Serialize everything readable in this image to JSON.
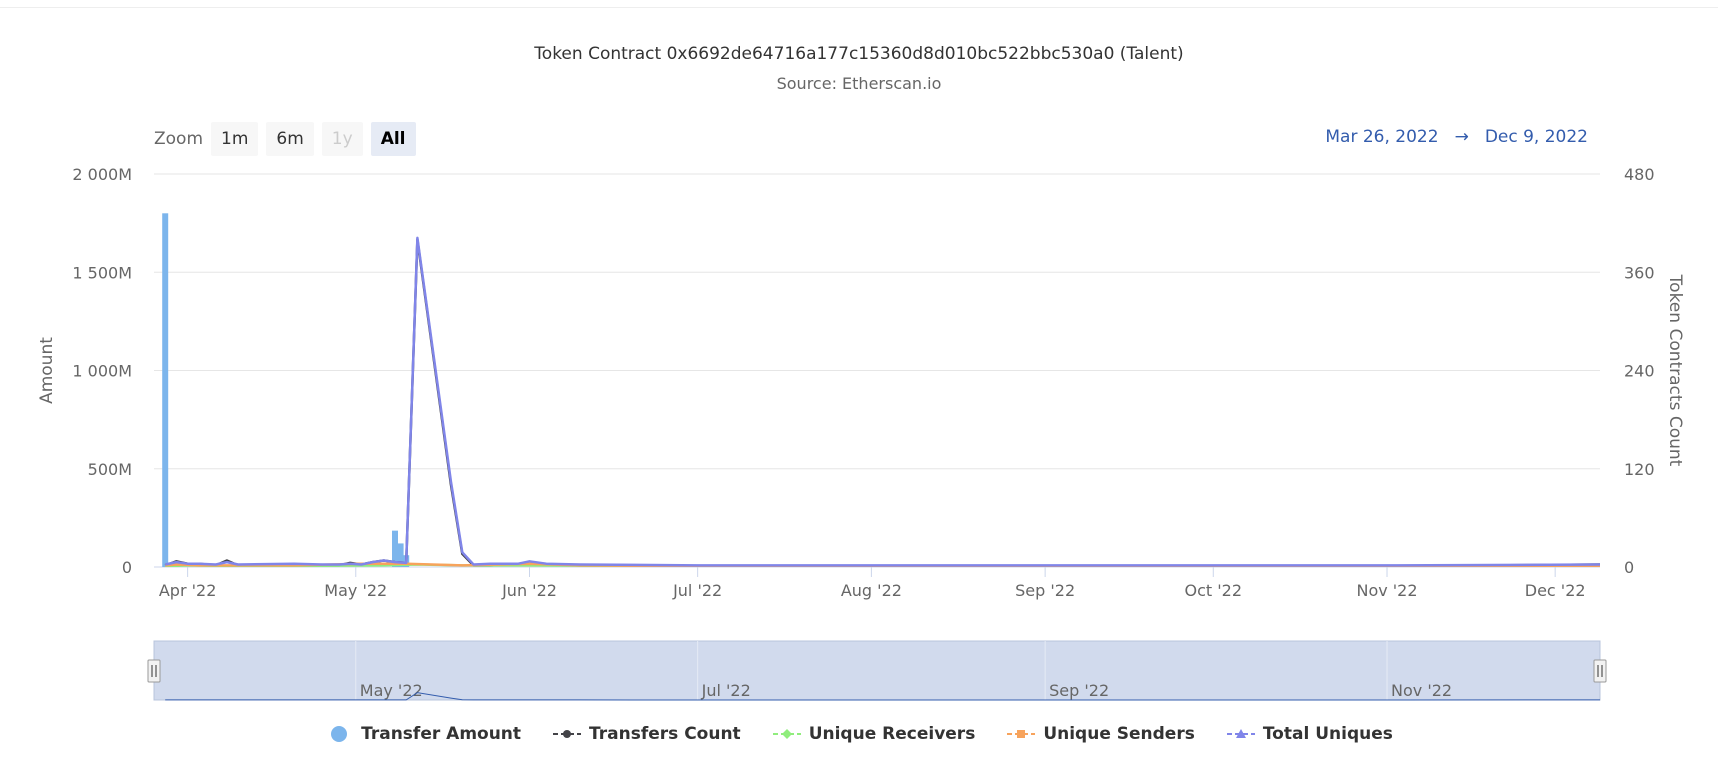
{
  "colors": {
    "transfer_amount": "#7cb5ec",
    "transfers_count": "#434348",
    "unique_receivers": "#90ed7d",
    "unique_senders": "#f7a35c",
    "total_uniques": "#8085e9",
    "navigator_fill": "#ccd6eb",
    "range_text": "#335cad"
  },
  "zoom": {
    "label": "Zoom",
    "buttons": [
      {
        "label": "1m",
        "state": "normal"
      },
      {
        "label": "6m",
        "state": "normal"
      },
      {
        "label": "1y",
        "state": "disabled"
      },
      {
        "label": "All",
        "state": "active"
      }
    ]
  },
  "range": {
    "from": "Mar 26, 2022",
    "arrow": "→",
    "to": "Dec 9, 2022"
  },
  "chart_data": {
    "type": "line",
    "title": "Token Contract 0x6692de64716a177c15360d8d010bc522bbc530a0 (Talent)",
    "subtitle": "Source: Etherscan.io",
    "x_range": [
      "2022-03-26",
      "2022-12-09"
    ],
    "x_ticks": [
      {
        "date": "2022-04-01",
        "label": "Apr '22"
      },
      {
        "date": "2022-05-01",
        "label": "May '22"
      },
      {
        "date": "2022-06-01",
        "label": "Jun '22"
      },
      {
        "date": "2022-07-01",
        "label": "Jul '22"
      },
      {
        "date": "2022-08-01",
        "label": "Aug '22"
      },
      {
        "date": "2022-09-01",
        "label": "Sep '22"
      },
      {
        "date": "2022-10-01",
        "label": "Oct '22"
      },
      {
        "date": "2022-11-01",
        "label": "Nov '22"
      },
      {
        "date": "2022-12-01",
        "label": "Dec '22"
      }
    ],
    "y_left": {
      "label": "Amount",
      "range": [
        0,
        2000
      ],
      "ticks": [
        "0",
        "500M",
        "1 000M",
        "1 500M",
        "2 000M"
      ]
    },
    "y_right": {
      "label": "Token Contracts Count",
      "range": [
        0,
        480
      ],
      "ticks": [
        "0",
        "120",
        "240",
        "360",
        "480"
      ]
    },
    "grid": true,
    "legend_position": "bottom",
    "series": [
      {
        "name": "Transfer Amount",
        "axis": "left",
        "kind": "column",
        "unit": "M",
        "points": [
          [
            "2022-03-28",
            1800
          ],
          [
            "2022-05-08",
            185
          ],
          [
            "2022-05-09",
            120
          ],
          [
            "2022-05-10",
            60
          ]
        ]
      },
      {
        "name": "Transfers Count",
        "axis": "right",
        "kind": "line",
        "points": [
          [
            "2022-03-28",
            2
          ],
          [
            "2022-03-30",
            7
          ],
          [
            "2022-04-01",
            4
          ],
          [
            "2022-04-03",
            4
          ],
          [
            "2022-04-06",
            2
          ],
          [
            "2022-04-08",
            8
          ],
          [
            "2022-04-10",
            2
          ],
          [
            "2022-04-20",
            3
          ],
          [
            "2022-04-25",
            2
          ],
          [
            "2022-04-28",
            2
          ],
          [
            "2022-04-30",
            5
          ],
          [
            "2022-05-02",
            3
          ],
          [
            "2022-05-04",
            6
          ],
          [
            "2022-05-06",
            8
          ],
          [
            "2022-05-08",
            6
          ],
          [
            "2022-05-10",
            5
          ],
          [
            "2022-05-12",
            400
          ],
          [
            "2022-05-18",
            100
          ],
          [
            "2022-05-20",
            16
          ],
          [
            "2022-05-22",
            2
          ],
          [
            "2022-05-25",
            2
          ],
          [
            "2022-05-30",
            3
          ],
          [
            "2022-06-01",
            6
          ],
          [
            "2022-06-04",
            3
          ],
          [
            "2022-06-10",
            2
          ],
          [
            "2022-07-01",
            1
          ],
          [
            "2022-09-01",
            1
          ],
          [
            "2022-11-01",
            1
          ],
          [
            "2022-12-09",
            3
          ]
        ]
      },
      {
        "name": "Unique Receivers",
        "axis": "right",
        "kind": "line",
        "points": [
          [
            "2022-03-28",
            1
          ],
          [
            "2022-04-01",
            2
          ],
          [
            "2022-04-10",
            1
          ],
          [
            "2022-05-05",
            2
          ],
          [
            "2022-05-12",
            3
          ],
          [
            "2022-05-20",
            2
          ],
          [
            "2022-06-01",
            2
          ],
          [
            "2022-07-01",
            1
          ],
          [
            "2022-12-09",
            1
          ]
        ]
      },
      {
        "name": "Unique Senders",
        "axis": "right",
        "kind": "line",
        "points": [
          [
            "2022-03-28",
            2
          ],
          [
            "2022-03-30",
            3
          ],
          [
            "2022-04-03",
            2
          ],
          [
            "2022-04-20",
            2
          ],
          [
            "2022-05-02",
            4
          ],
          [
            "2022-05-10",
            4
          ],
          [
            "2022-05-20",
            2
          ],
          [
            "2022-06-01",
            4
          ],
          [
            "2022-06-10",
            2
          ],
          [
            "2022-07-01",
            1
          ],
          [
            "2022-12-09",
            1
          ]
        ]
      },
      {
        "name": "Total Uniques",
        "axis": "right",
        "kind": "line",
        "points": [
          [
            "2022-03-28",
            3
          ],
          [
            "2022-03-30",
            6
          ],
          [
            "2022-04-01",
            4
          ],
          [
            "2022-04-03",
            4
          ],
          [
            "2022-04-06",
            3
          ],
          [
            "2022-04-08",
            6
          ],
          [
            "2022-04-10",
            3
          ],
          [
            "2022-04-20",
            4
          ],
          [
            "2022-04-25",
            3
          ],
          [
            "2022-04-28",
            3
          ],
          [
            "2022-04-30",
            4
          ],
          [
            "2022-05-02",
            3
          ],
          [
            "2022-05-04",
            6
          ],
          [
            "2022-05-06",
            8
          ],
          [
            "2022-05-08",
            6
          ],
          [
            "2022-05-10",
            5
          ],
          [
            "2022-05-12",
            402
          ],
          [
            "2022-05-18",
            104
          ],
          [
            "2022-05-20",
            18
          ],
          [
            "2022-05-22",
            3
          ],
          [
            "2022-05-25",
            4
          ],
          [
            "2022-05-30",
            4
          ],
          [
            "2022-06-01",
            7
          ],
          [
            "2022-06-04",
            4
          ],
          [
            "2022-06-10",
            3
          ],
          [
            "2022-07-01",
            2
          ],
          [
            "2022-09-01",
            2
          ],
          [
            "2022-11-01",
            2
          ],
          [
            "2022-12-09",
            3
          ]
        ]
      }
    ],
    "navigator": {
      "ticks": [
        {
          "date": "2022-05-01",
          "label": "May '22"
        },
        {
          "date": "2022-07-01",
          "label": "Jul '22"
        },
        {
          "date": "2022-09-01",
          "label": "Sep '22"
        },
        {
          "date": "2022-11-01",
          "label": "Nov '22"
        }
      ]
    }
  }
}
